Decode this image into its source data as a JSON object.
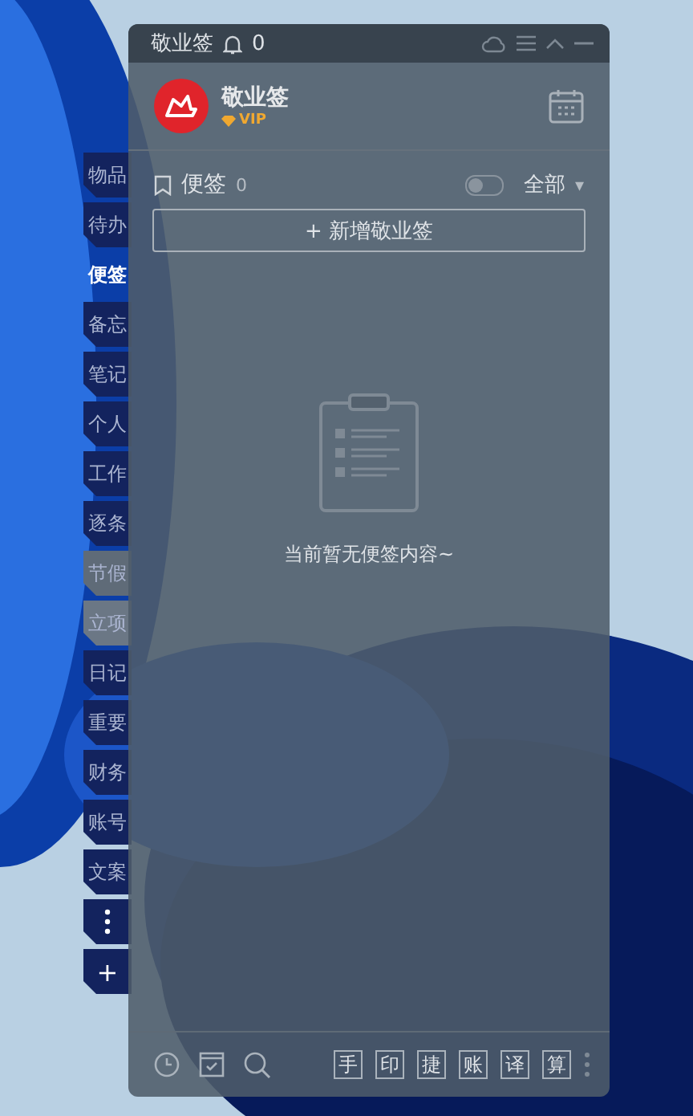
{
  "side_tabs": [
    {
      "label": "物品",
      "selected": false,
      "color": "#13235e"
    },
    {
      "label": "待办",
      "selected": false,
      "color": "#13235e"
    },
    {
      "label": "便签",
      "selected": true
    },
    {
      "label": "备忘",
      "selected": false,
      "color": "#13235e"
    },
    {
      "label": "笔记",
      "selected": false,
      "color": "#13235e"
    },
    {
      "label": "个人",
      "selected": false,
      "color": "#13235e"
    },
    {
      "label": "工作",
      "selected": false,
      "color": "#13235e"
    },
    {
      "label": "逐条",
      "selected": false,
      "color": "#13235e"
    },
    {
      "label": "节假",
      "selected": false,
      "color": "#5f6b78"
    },
    {
      "label": "立项",
      "selected": false,
      "color": "#6b7785"
    },
    {
      "label": "日记",
      "selected": false,
      "color": "#13235e"
    },
    {
      "label": "重要",
      "selected": false,
      "color": "#13235e"
    },
    {
      "label": "财务",
      "selected": false,
      "color": "#13235e"
    },
    {
      "label": "账号",
      "selected": false,
      "color": "#13235e"
    },
    {
      "label": "文案",
      "selected": false,
      "color": "#13235e"
    }
  ],
  "side_add": "+",
  "window": {
    "title": "敬业签",
    "notifications": "0"
  },
  "profile": {
    "name": "敬业签",
    "badge": "VIP"
  },
  "section": {
    "title": "便签",
    "count": "0",
    "toggle_on": false,
    "filter": "全部",
    "filter_caret": "▾"
  },
  "add_button": "+ 新增敬业签",
  "empty_message": "当前暂无便签内容~",
  "tools": [
    "手",
    "印",
    "捷",
    "账",
    "译",
    "算"
  ]
}
